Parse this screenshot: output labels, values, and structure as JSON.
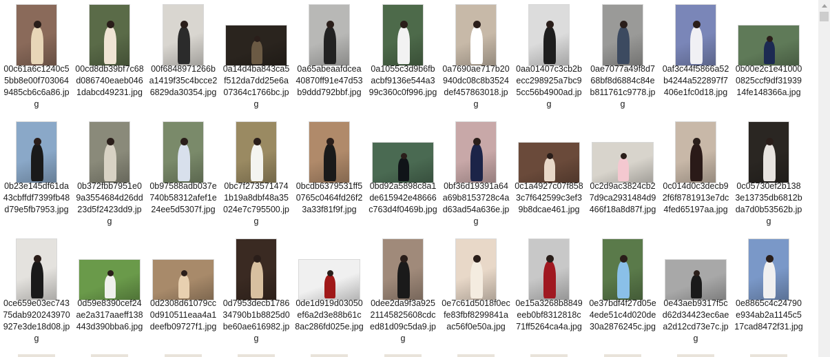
{
  "files": [
    {
      "name": "00c61a6c1240c55bb8e00f7030649485cb6c6a86.jpg",
      "orientation": "portrait",
      "bg": "#8a6a5a",
      "fg": "#e8d6b8"
    },
    {
      "name": "00cd8db39bf7c68d086740eaeb0461dabcd49231.jpg",
      "orientation": "portrait",
      "bg": "#5a6b48",
      "fg": "#efe4d4"
    },
    {
      "name": "00f6848971266ba1419f35c4bcce26829da30354.jpg",
      "orientation": "portrait",
      "bg": "#d9d6d0",
      "fg": "#2b2b2b"
    },
    {
      "name": "0a14d4ba843ca5f512da7dd25e6a07364c1766bc.jpg",
      "orientation": "landscape",
      "bg": "#2a241e",
      "fg": "#6b5a44"
    },
    {
      "name": "0a65abeaafdcea40870ff91e47d53b9ddd792bbf.jpg",
      "orientation": "portrait",
      "bg": "#b8b8b6",
      "fg": "#222222"
    },
    {
      "name": "0a1055c3d9b6fbacbf9136e544a399c360c0f996.jpg",
      "orientation": "portrait",
      "bg": "#4d6a4a",
      "fg": "#f2f2f2"
    },
    {
      "name": "0a7690ae717b20940dc08c8b3524def457863018.jpg",
      "orientation": "portrait",
      "bg": "#c7b9a8",
      "fg": "#ffffff"
    },
    {
      "name": "0aa01407c3cb2becc298925a7bc95cc56b4900ad.jpg",
      "orientation": "portrait",
      "bg": "#dcdcdc",
      "fg": "#1e1e1e"
    },
    {
      "name": "0ae7077a49f8d768bf8d6884c84eb811761c9778.jpg",
      "orientation": "portrait",
      "bg": "#9a9a98",
      "fg": "#3c4a60"
    },
    {
      "name": "0af3c44f5866a52b4244a522897f7406e1fc0d18.jpg",
      "orientation": "portrait",
      "bg": "#7a86b8",
      "fg": "#f0f0f4"
    },
    {
      "name": "0b00e2c1e410000825ccf9df3193914fe148366a.jpg",
      "orientation": "landscape",
      "bg": "#5f7a58",
      "fg": "#1c2a52"
    },
    {
      "name": "0b23e145df61da43cbffdf7399fb48d79e5fb7953.jpg",
      "orientation": "portrait",
      "bg": "#8aa8c8",
      "fg": "#1a1a1a"
    },
    {
      "name": "0b372fbb7951e09a3554684d26dd23d5f2423dd9.jpg",
      "orientation": "portrait",
      "bg": "#8a8a7a",
      "fg": "#d8d2c4"
    },
    {
      "name": "0b97588adb037e740b58312afef1e24ee5d5307f.jpg",
      "orientation": "portrait",
      "bg": "#7a8a6a",
      "fg": "#d8e0ec"
    },
    {
      "name": "0bc7f2735714741b19a8dbf48a35024e7c795500.jpg",
      "orientation": "portrait",
      "bg": "#9a8a62",
      "fg": "#f4f4f0"
    },
    {
      "name": "0bcdb6379531ff50765c0464fd26f23a33f81f9f.jpg",
      "orientation": "portrait",
      "bg": "#b08a6a",
      "fg": "#1a1a1a"
    },
    {
      "name": "0bd92a5898c8a1de615942e48666c763d4f0469b.jpg",
      "orientation": "landscape",
      "bg": "#4a6a52",
      "fg": "#101418"
    },
    {
      "name": "0bf36d19391a64a69b8153728c4ad63ad54a636e.jpg",
      "orientation": "portrait",
      "bg": "#c8a8a8",
      "fg": "#1c2448"
    },
    {
      "name": "0c1a4927c07f8583c7f642599c3ef39b8dcae461.jpg",
      "orientation": "landscape",
      "bg": "#6a4a3a",
      "fg": "#e8d8c8"
    },
    {
      "name": "0c2d9ac3824cb27d9ca2931484d9466f18a8d87f.jpg",
      "orientation": "landscape",
      "bg": "#d8d4cc",
      "fg": "#f4c8d0"
    },
    {
      "name": "0c014d0c3decb92f6f8781913e7dc4fed65197aa.jpg",
      "orientation": "portrait",
      "bg": "#c8b8a8",
      "fg": "#2a1a18"
    },
    {
      "name": "0c05730ef2b1383e13735db6812bda7d0b53562b.jpg",
      "orientation": "portrait",
      "bg": "#2a2622",
      "fg": "#e8e4e0"
    },
    {
      "name": "0ce659e03ec74375dab920243970927e3de18d08.jpg",
      "orientation": "portrait",
      "bg": "#e4e2de",
      "fg": "#1a1a1a"
    },
    {
      "name": "0d59e8390cef24ae2a317aaeff138443d390bba6.jpg",
      "orientation": "landscape",
      "bg": "#6a9a4a",
      "fg": "#f0f0ec"
    },
    {
      "name": "0d2308d61079cc0d910511eaa4a1deefb09727f1.jpg",
      "orientation": "landscape",
      "bg": "#a88a6a",
      "fg": "#e8d0b0"
    },
    {
      "name": "0d7953decb178634790b1b8825d0be60ae616982.jpg",
      "orientation": "portrait",
      "bg": "#3a2a22",
      "fg": "#d8c0a0"
    },
    {
      "name": "0de1d919d03050ef6a2d3e88b61c8ac286fd025e.jpg",
      "orientation": "landscape",
      "bg": "#f0f0f0",
      "fg": "#a01818"
    },
    {
      "name": "0dee2da9f3a92521145825608cdced81d09c5da9.jpg",
      "orientation": "portrait",
      "bg": "#a08a7a",
      "fg": "#1a1a1a"
    },
    {
      "name": "0e7c61d5018f0ecfe83fbf8299841aac56f0e50a.jpg",
      "orientation": "portrait",
      "bg": "#e8d8c8",
      "fg": "#f4ece0"
    },
    {
      "name": "0e15a3268b8849eeb0bf8312818c71ff5264ca4a.jpg",
      "orientation": "portrait",
      "bg": "#c8c8c8",
      "fg": "#a01820"
    },
    {
      "name": "0e37bdf4f27d05e4ede51c4d020de30a2876245c.jpg",
      "orientation": "portrait",
      "bg": "#5a7a4a",
      "fg": "#8ac0e8"
    },
    {
      "name": "0e43aeb9317f5cd62d34423ec6aea2d12cd73e7c.jpg",
      "orientation": "landscape",
      "bg": "#a8a8a8",
      "fg": "#1a1a1a"
    },
    {
      "name": "0e8865c4c24790e934ab2a1145c517cad8472f31.jpg",
      "orientation": "portrait",
      "bg": "#7a98c8",
      "fg": "#f0f0f0"
    }
  ],
  "colors": {
    "label_text": "#1a1a1a",
    "thumb_border": "#d8d8d8",
    "scrollbar_track": "#f0f0f0",
    "scrollbar_thumb": "#cdcdcd"
  }
}
